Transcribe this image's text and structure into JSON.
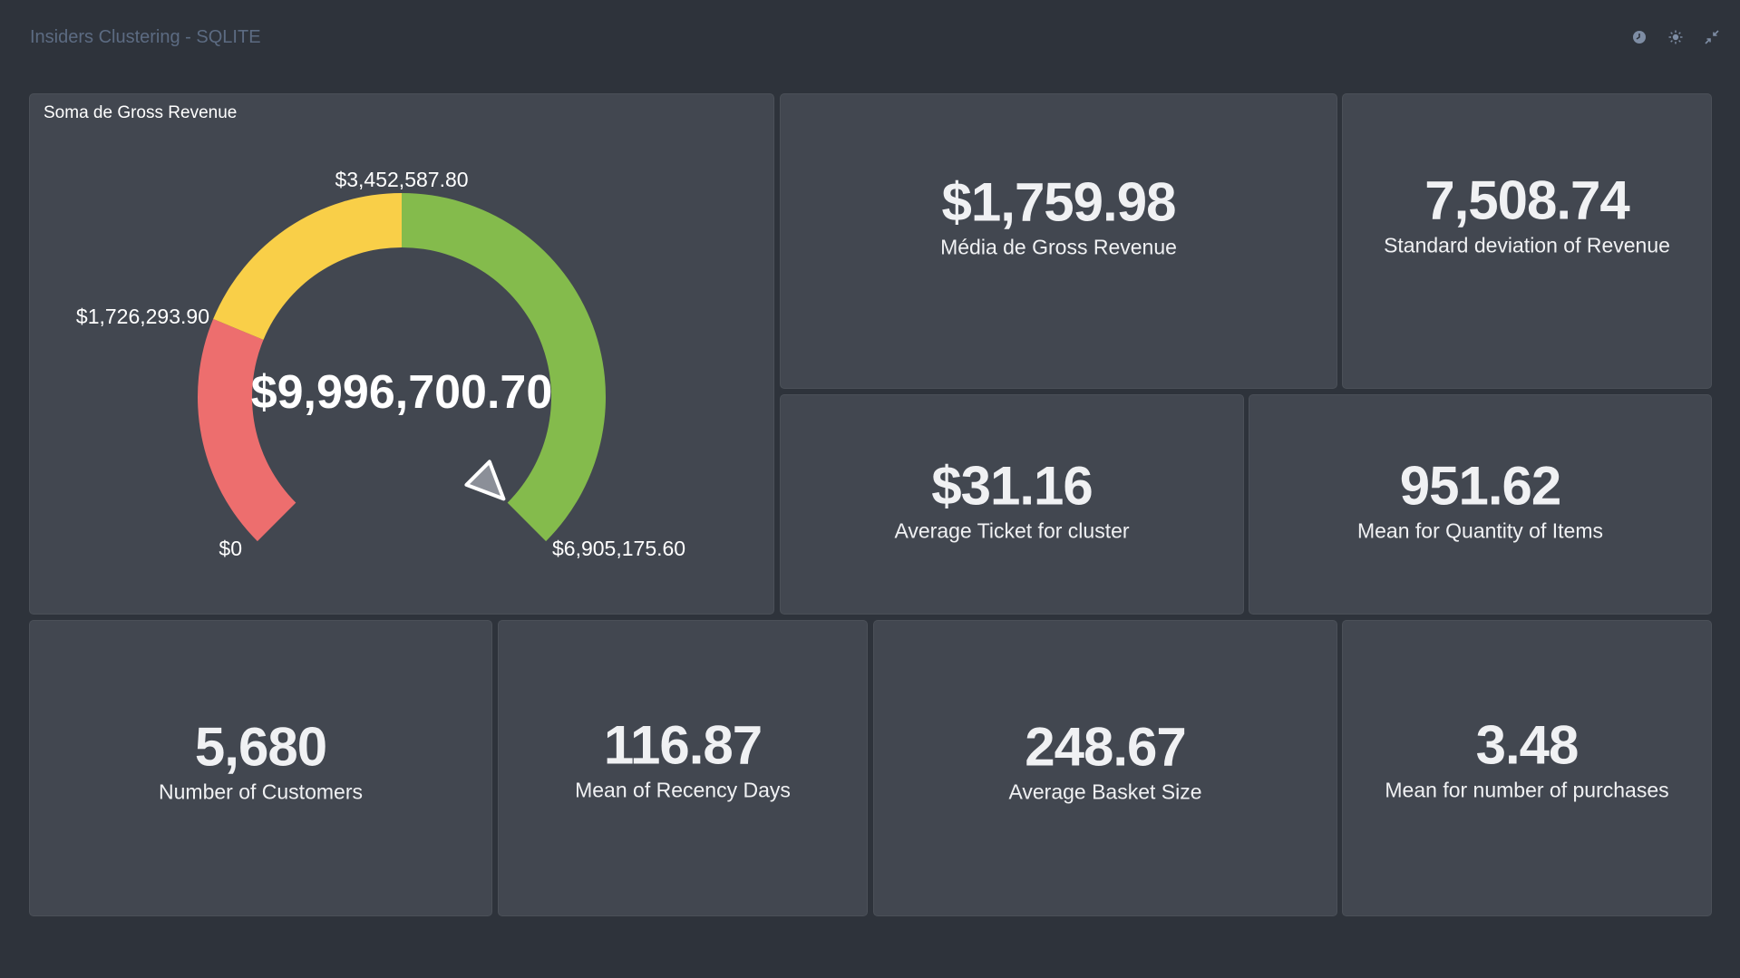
{
  "dashboard": {
    "title": "Insiders Clustering - SQLITE",
    "icons": [
      "clock-icon",
      "sun-icon",
      "collapse-icon"
    ]
  },
  "gauge": {
    "title": "Soma de Gross Revenue",
    "value_label": "$9,996,700.70",
    "value": 9996700.7,
    "min": 0,
    "max": 6905175.6,
    "ticks": [
      "$0",
      "$1,726,293.90",
      "$3,452,587.80",
      "$6,905,175.60"
    ],
    "segments": [
      {
        "from": 0,
        "to": 1726293.9,
        "color": "#ed6e6e"
      },
      {
        "from": 1726293.9,
        "to": 3452587.8,
        "color": "#f9cf48"
      },
      {
        "from": 3452587.8,
        "to": 6905175.6,
        "color": "#84bb4c"
      }
    ]
  },
  "cards": {
    "mean_gross_revenue": {
      "value": "$1,759.98",
      "label": "Média de Gross Revenue"
    },
    "std_revenue": {
      "value": "7,508.74",
      "label": "Standard deviation of Revenue"
    },
    "avg_ticket": {
      "value": "$31.16",
      "label": "Average Ticket for cluster"
    },
    "mean_qty_items": {
      "value": "951.62",
      "label": "Mean for Quantity of Items"
    },
    "num_customers": {
      "value": "5,680",
      "label": "Number of Customers"
    },
    "mean_recency": {
      "value": "116.87",
      "label": "Mean of Recency Days"
    },
    "avg_basket": {
      "value": "248.67",
      "label": "Average Basket Size"
    },
    "mean_purchases": {
      "value": "3.48",
      "label": "Mean for number of purchases"
    }
  }
}
